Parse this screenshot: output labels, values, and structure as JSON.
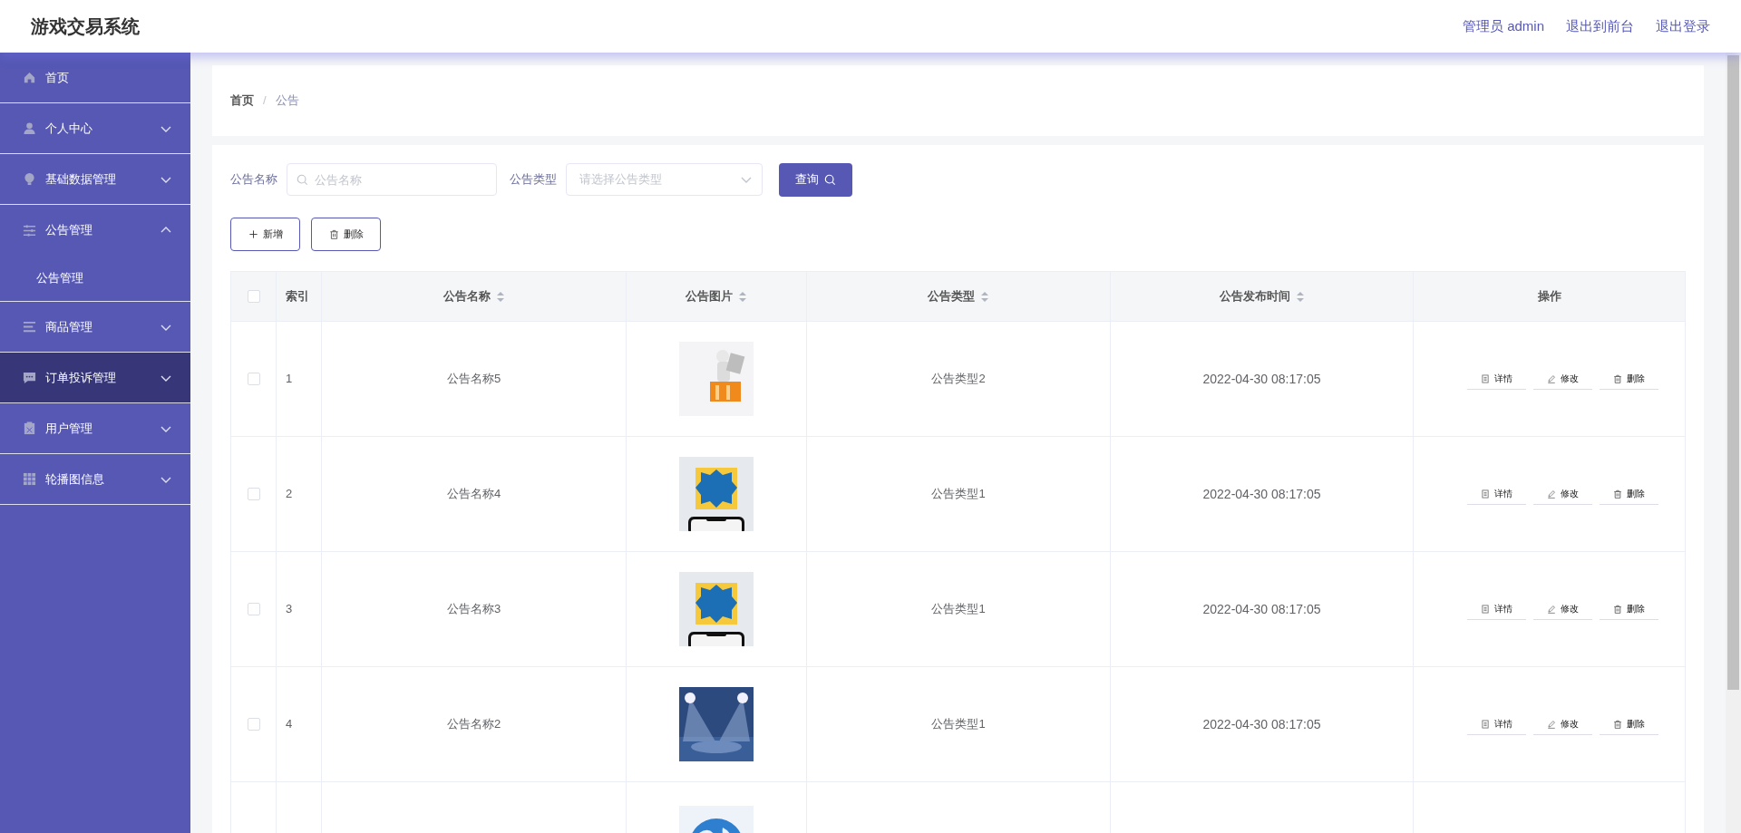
{
  "header": {
    "title": "游戏交易系统",
    "links": [
      {
        "label": "管理员 admin"
      },
      {
        "label": "退出到前台"
      },
      {
        "label": "退出登录"
      }
    ]
  },
  "sidebar": {
    "items": [
      {
        "label": "首页",
        "selected": false
      },
      {
        "label": "个人中心",
        "selected": false,
        "expanded": false
      },
      {
        "label": "基础数据管理",
        "selected": false,
        "expanded": false
      },
      {
        "label": "公告管理",
        "selected": false,
        "expanded": true,
        "children": [
          {
            "label": "公告管理",
            "selected": false
          }
        ]
      },
      {
        "label": "商品管理",
        "selected": false,
        "expanded": false
      },
      {
        "label": "订单投诉管理",
        "selected": true,
        "expanded": false
      },
      {
        "label": "用户管理",
        "selected": false,
        "expanded": false
      },
      {
        "label": "轮播图信息",
        "selected": false,
        "expanded": false
      }
    ]
  },
  "breadcrumb": {
    "separator": "/",
    "items": [
      {
        "label": "首页"
      },
      {
        "label": "公告"
      }
    ]
  },
  "search": {
    "fields": [
      {
        "label": "公告名称",
        "kind": "text",
        "placeholder": "公告名称"
      },
      {
        "label": "公告类型",
        "kind": "select",
        "placeholder": "请选择公告类型"
      }
    ],
    "button": "查询"
  },
  "actions": [
    "新增",
    "删除"
  ],
  "table": {
    "all_checked": false,
    "columns": [
      {
        "label": "索引",
        "sortable": false
      },
      {
        "label": "公告名称",
        "sortable": true
      },
      {
        "label": "公告图片",
        "sortable": true
      },
      {
        "label": "公告类型",
        "sortable": true
      },
      {
        "label": "公告发布时间",
        "sortable": true
      },
      {
        "label": "操作",
        "sortable": false
      }
    ],
    "rows": [
      {
        "checked": false,
        "index": "1",
        "name": "公告名称5",
        "image": {
          "kind": "picture"
        },
        "type": "公告类型2",
        "time": "2022-04-30 08:17:05",
        "buttons": [
          "详情",
          "修改",
          "删除"
        ]
      },
      {
        "checked": false,
        "index": "2",
        "name": "公告名称4",
        "image": {
          "kind": "picture"
        },
        "type": "公告类型1",
        "time": "2022-04-30 08:17:05",
        "buttons": [
          "详情",
          "修改",
          "删除"
        ]
      },
      {
        "checked": false,
        "index": "3",
        "name": "公告名称3",
        "image": {
          "kind": "picture"
        },
        "type": "公告类型1",
        "time": "2022-04-30 08:17:05",
        "buttons": [
          "详情",
          "修改",
          "删除"
        ]
      },
      {
        "checked": false,
        "index": "4",
        "name": "公告名称2",
        "image": {
          "kind": "picture"
        },
        "type": "公告类型1",
        "time": "2022-04-30 08:17:05",
        "buttons": [
          "详情",
          "修改",
          "删除"
        ]
      },
      {
        "image": {
          "kind": "picture"
        }
      }
    ]
  }
}
